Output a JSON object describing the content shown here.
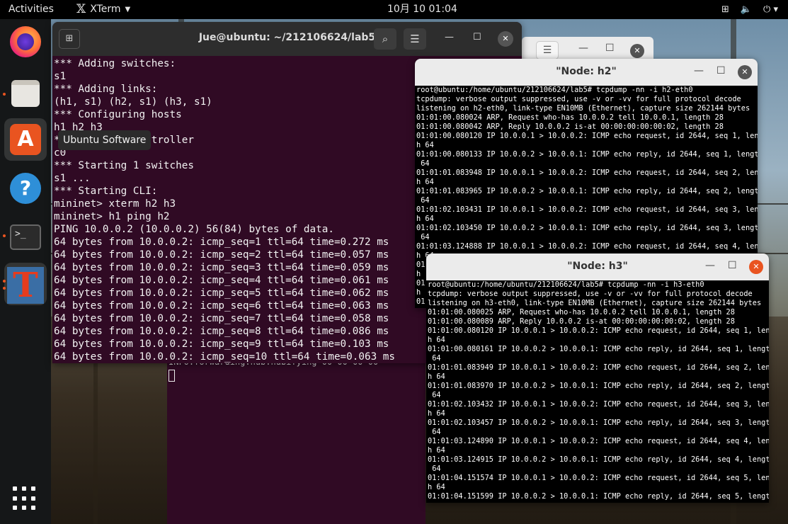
{
  "topbar": {
    "activities": "Activities",
    "app_name": "XTerm",
    "clock": "10月 10  01:04",
    "tray": {
      "network_icon": "network-icon",
      "volume_icon": "volume-icon",
      "power_icon": "power-icon"
    }
  },
  "dock": {
    "items": [
      "Firefox",
      "Files",
      "Ubuntu Software",
      "Help",
      "Terminal",
      "XTerm",
      "Show Applications"
    ],
    "tooltip": "Ubuntu Software"
  },
  "main_terminal": {
    "title": "Jue@ubuntu: ~/212106624/lab5",
    "lines": [
      "*** Adding switches:",
      "s1",
      "*** Adding links:",
      "(h1, s1) (h2, s1) (h3, s1)",
      "*** Configuring hosts",
      "h1 h2 h3",
      "*** Starting controller",
      "c0",
      "*** Starting 1 switches",
      "s1 ...",
      "*** Starting CLI:",
      "mininet> xterm h2 h3",
      "mininet> h1 ping h2",
      "PING 10.0.0.2 (10.0.0.2) 56(84) bytes of data.",
      "64 bytes from 10.0.0.2: icmp_seq=1 ttl=64 time=0.272 ms",
      "64 bytes from 10.0.0.2: icmp_seq=2 ttl=64 time=0.057 ms",
      "64 bytes from 10.0.0.2: icmp_seq=3 ttl=64 time=0.059 ms",
      "64 bytes from 10.0.0.2: icmp_seq=4 ttl=64 time=0.061 ms",
      "64 bytes from 10.0.0.2: icmp_seq=5 ttl=64 time=0.062 ms",
      "64 bytes from 10.0.0.2: icmp_seq=6 ttl=64 time=0.063 ms",
      "64 bytes from 10.0.0.2: icmp_seq=7 ttl=64 time=0.058 ms",
      "64 bytes from 10.0.0.2: icmp_seq=8 ttl=64 time=0.086 ms",
      "64 bytes from 10.0.0.2: icmp_seq=9 ttl=64 time=0.103 ms",
      "64 bytes from 10.0.0.2: icmp_seq=10 ttl=64 time=0.063 ms"
    ]
  },
  "bg_xterm": {
    "line": "INFO:forwarding.hub:hubifying 00-00-00-00"
  },
  "node_h2": {
    "title": "\"Node: h2\"",
    "lines": [
      "root@ubuntu:/home/ubuntu/212106624/lab5# tcpdump -nn -i h2-eth0",
      "tcpdump: verbose output suppressed, use -v or -vv for full protocol decode",
      "listening on h2-eth0, link-type EN10MB (Ethernet), capture size 262144 bytes",
      "01:01:00.080024 ARP, Request who-has 10.0.0.2 tell 10.0.0.1, length 28",
      "01:01:00.080042 ARP, Reply 10.0.0.2 is-at 00:00:00:00:00:02, length 28",
      "01:01:00.080120 IP 10.0.0.1 > 10.0.0.2: ICMP echo request, id 2644, seq 1, lengt",
      "h 64",
      "01:01:00.080133 IP 10.0.0.2 > 10.0.0.1: ICMP echo reply, id 2644, seq 1, length",
      " 64",
      "01:01:01.083948 IP 10.0.0.1 > 10.0.0.2: ICMP echo request, id 2644, seq 2, lengt",
      "h 64",
      "01:01:01.083965 IP 10.0.0.2 > 10.0.0.1: ICMP echo reply, id 2644, seq 2, length",
      " 64",
      "01:01:02.103431 IP 10.0.0.1 > 10.0.0.2: ICMP echo request, id 2644, seq 3, lengt",
      "h 64",
      "01:01:02.103450 IP 10.0.0.2 > 10.0.0.1: ICMP echo reply, id 2644, seq 3, length",
      " 64",
      "01:01:03.124888 IP 10.0.0.1 > 10.0.0.2: ICMP echo request, id 2644, seq 4, lengt",
      "h 64",
      "01",
      "h",
      "01",
      "h",
      "01"
    ]
  },
  "node_h3": {
    "title": "\"Node: h3\"",
    "lines": [
      "root@ubuntu:/home/ubuntu/212106624/lab5# tcpdump -nn -i h3-eth0",
      "tcpdump: verbose output suppressed, use -v or -vv for full protocol decode",
      "listening on h3-eth0, link-type EN10MB (Ethernet), capture size 262144 bytes",
      "01:01:00.080025 ARP, Request who-has 10.0.0.2 tell 10.0.0.1, length 28",
      "01:01:00.080089 ARP, Reply 10.0.0.2 is-at 00:00:00:00:00:02, length 28",
      "01:01:00.080120 IP 10.0.0.1 > 10.0.0.2: ICMP echo request, id 2644, seq 1, lengt",
      "h 64",
      "01:01:00.080161 IP 10.0.0.2 > 10.0.0.1: ICMP echo reply, id 2644, seq 1, length",
      " 64",
      "01:01:01.083949 IP 10.0.0.1 > 10.0.0.2: ICMP echo request, id 2644, seq 2, lengt",
      "h 64",
      "01:01:01.083970 IP 10.0.0.2 > 10.0.0.1: ICMP echo reply, id 2644, seq 2, length",
      " 64",
      "01:01:02.103432 IP 10.0.0.1 > 10.0.0.2: ICMP echo request, id 2644, seq 3, lengt",
      "h 64",
      "01:01:02.103457 IP 10.0.0.2 > 10.0.0.1: ICMP echo reply, id 2644, seq 3, length",
      " 64",
      "01:01:03.124890 IP 10.0.0.1 > 10.0.0.2: ICMP echo request, id 2644, seq 4, lengt",
      "h 64",
      "01:01:03.124915 IP 10.0.0.2 > 10.0.0.1: ICMP echo reply, id 2644, seq 4, length",
      " 64",
      "01:01:04.151574 IP 10.0.0.1 > 10.0.0.2: ICMP echo request, id 2644, seq 5, lengt",
      "h 64",
      "01:01:04.151599 IP 10.0.0.2 > 10.0.0.1: ICMP echo reply, id 2644, seq 5, length"
    ]
  },
  "colors": {
    "ubuntu_orange": "#e95420",
    "terminal_bg": "#300a24",
    "xterm_bg": "#000000"
  }
}
